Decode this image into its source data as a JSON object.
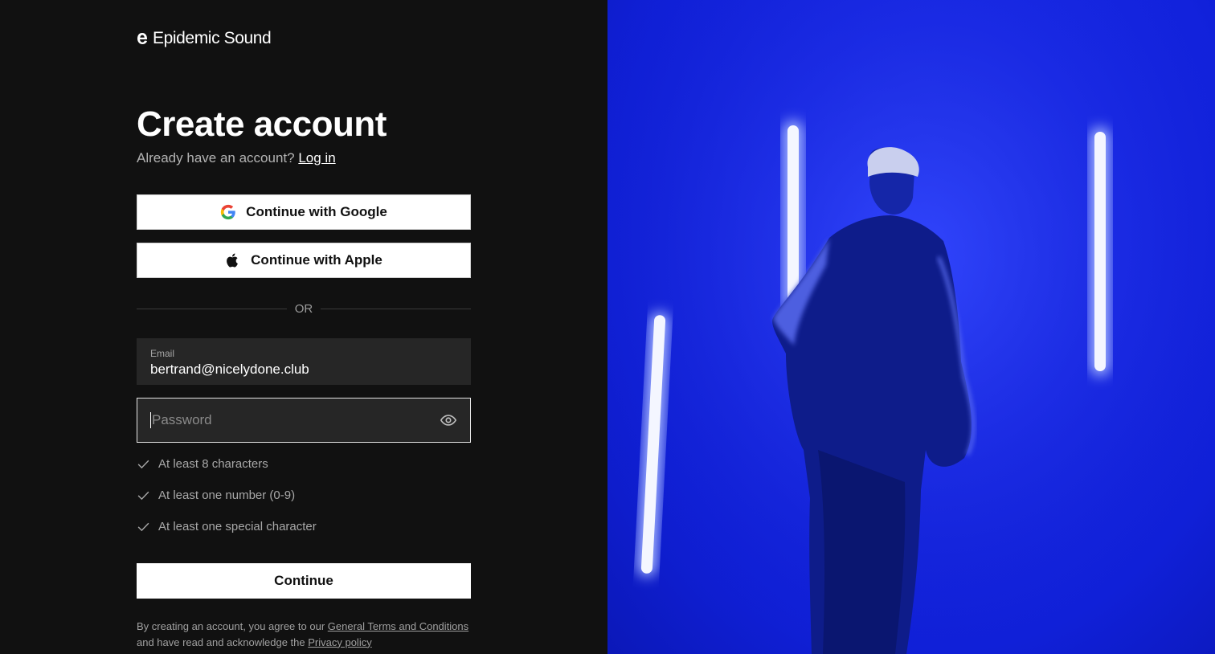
{
  "brand": {
    "name": "Epidemic Sound"
  },
  "heading": {
    "title": "Create account",
    "prompt": "Already have an account?",
    "login_link": "Log in"
  },
  "social": {
    "google_label": "Continue with Google",
    "apple_label": "Continue with Apple"
  },
  "divider_text": "OR",
  "email": {
    "label": "Email",
    "value": "bertrand@nicelydone.club"
  },
  "password": {
    "placeholder": "Password",
    "value": ""
  },
  "requirements": [
    "At least 8 characters",
    "At least one number (0-9)",
    "At least one special character"
  ],
  "continue_label": "Continue",
  "terms": {
    "prefix": "By creating an account, you agree to our",
    "terms_link": "General Terms and Conditions",
    "middle": "and have read and acknowledge the",
    "privacy_link": "Privacy policy"
  },
  "colors": {
    "background": "#111111",
    "panel_blue": "#1a2bef",
    "field": "#262626"
  },
  "icons": [
    "epidemic-logo-icon",
    "google-icon",
    "apple-icon",
    "eye-icon",
    "check-icon"
  ]
}
